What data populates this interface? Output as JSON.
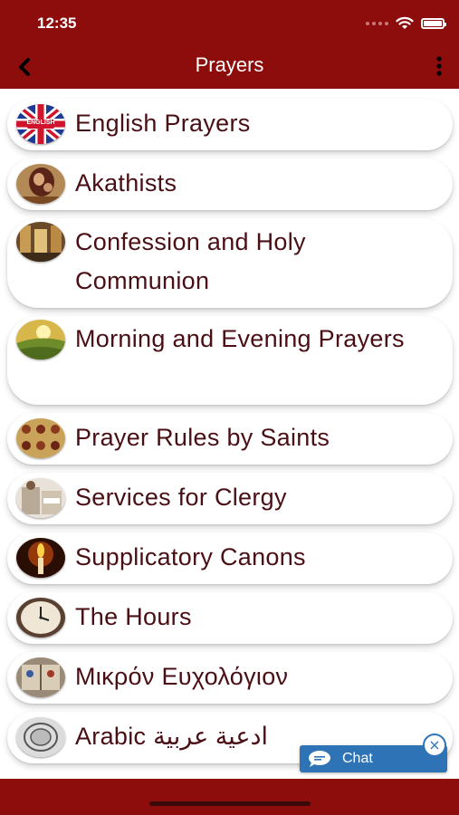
{
  "status_bar": {
    "time": "12:35"
  },
  "header": {
    "title": "Prayers",
    "back_icon": "chevron-left-icon",
    "menu_icon": "more-vertical-icon"
  },
  "colors": {
    "brand": "#8d0d0d",
    "text": "#4a0f14",
    "chat": "#2f73b7"
  },
  "items": [
    {
      "label": "English Prayers",
      "icon": "uk-flag-icon",
      "badge": "ENGLISH"
    },
    {
      "label": "Akathists",
      "icon": "icon-theotokos"
    },
    {
      "label": "Confession and Holy Communion",
      "icon": "icon-church-interior"
    },
    {
      "label": "Morning and Evening Prayers",
      "icon": "sunrise-landscape-icon"
    },
    {
      "label": "Prayer Rules by Saints",
      "icon": "icon-saints"
    },
    {
      "label": "Services for Clergy",
      "icon": "icon-clergy"
    },
    {
      "label": "Supplicatory Canons",
      "icon": "candle-icon"
    },
    {
      "label": "The Hours",
      "icon": "clock-icon"
    },
    {
      "label": "Μικρόν Ευχολόγιον",
      "icon": "icon-book"
    },
    {
      "label": "Arabic ادعية عربية",
      "icon": "arabic-seal-icon"
    }
  ],
  "chat": {
    "label": "Chat",
    "close": "×"
  }
}
